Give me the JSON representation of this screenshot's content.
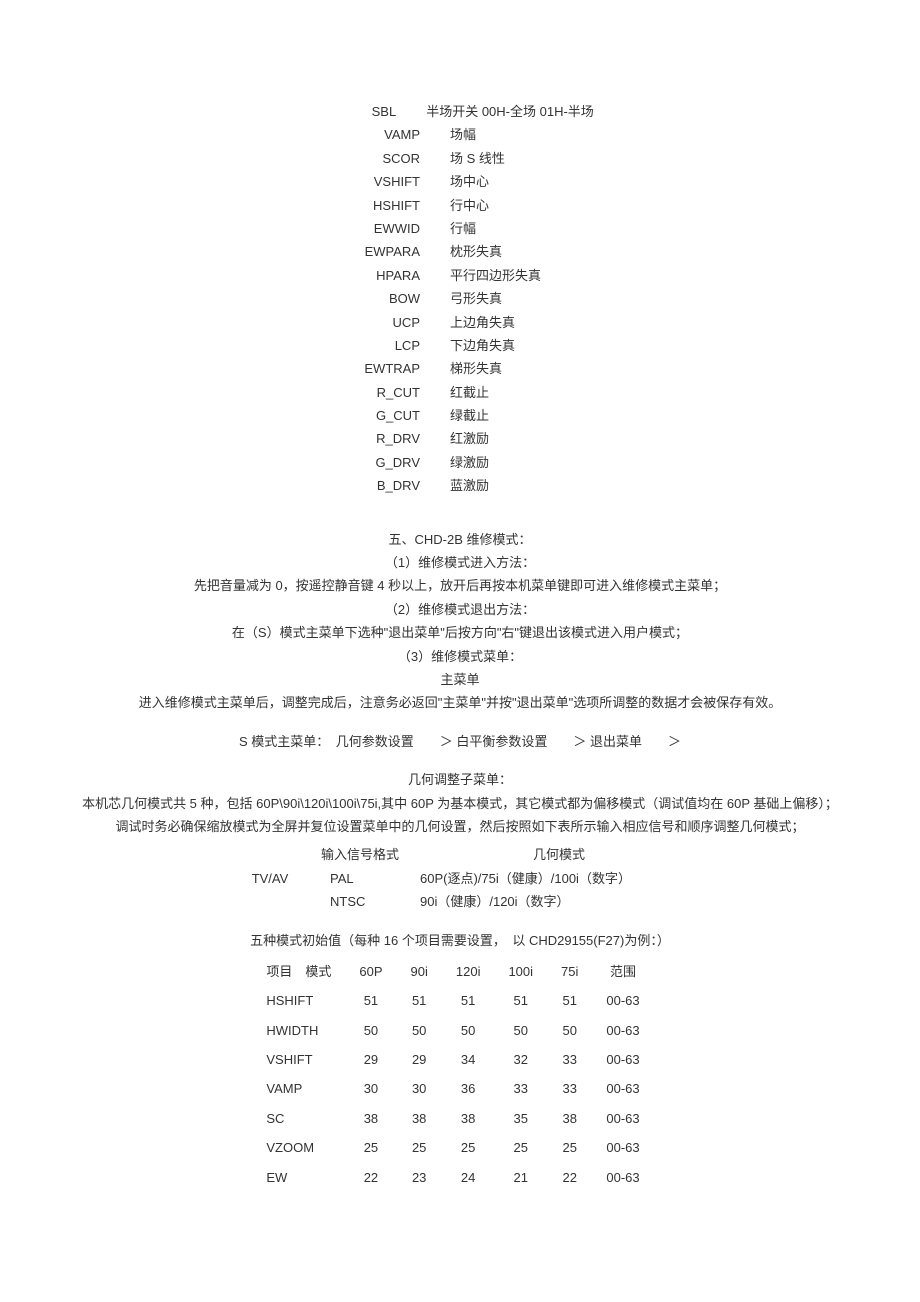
{
  "params": [
    {
      "k": "SBL",
      "v": "半场开关 00H-全场 01H-半场"
    },
    {
      "k": "VAMP",
      "v": "场幅"
    },
    {
      "k": "SCOR",
      "v": "场 S 线性"
    },
    {
      "k": "VSHIFT",
      "v": "场中心"
    },
    {
      "k": "HSHIFT",
      "v": "行中心"
    },
    {
      "k": "EWWID",
      "v": "行幅"
    },
    {
      "k": "EWPARA",
      "v": "枕形失真"
    },
    {
      "k": "HPARA",
      "v": "平行四边形失真"
    },
    {
      "k": "BOW",
      "v": "弓形失真"
    },
    {
      "k": "UCP",
      "v": "上边角失真"
    },
    {
      "k": "LCP",
      "v": "下边角失真"
    },
    {
      "k": "EWTRAP",
      "v": "梯形失真"
    },
    {
      "k": "R_CUT",
      "v": "红截止"
    },
    {
      "k": "G_CUT",
      "v": "绿截止"
    },
    {
      "k": "R_DRV",
      "v": "红激励"
    },
    {
      "k": "G_DRV",
      "v": "绿激励"
    },
    {
      "k": "B_DRV",
      "v": "蓝激励"
    }
  ],
  "s5_title": "五、CHD-2B 维修模式：",
  "s5_1": "（1）维修模式进入方法：",
  "s5_1_body": "先把音量减为 0，按遥控静音键 4 秒以上，放开后再按本机菜单键即可进入维修模式主菜单；",
  "s5_2": "（2）维修模式退出方法：",
  "s5_2_body": "在（S）模式主菜单下选种\"退出菜单\"后按方向\"右\"键退出该模式进入用户模式；",
  "s5_3": "（3）维修模式菜单：",
  "main_menu_label": "主菜单",
  "main_menu_note": "进入维修模式主菜单后，调整完成后，注意务必返回\"主菜单\"并按\"退出菜单\"选项所调整的数据才会被保存有效。",
  "s_menu_line": "S 模式主菜单：　几何参数设置　　＞ 白平衡参数设置　　＞ 退出菜单　　＞",
  "geo_title": "几何调整子菜单：",
  "geo_p1": "本机芯几何模式共 5 种，包括 60P\\90i\\120i\\100i\\75i,其中 60P 为基本模式，其它模式都为偏移模式（调试值均在 60P 基础上偏移）；",
  "geo_p2": "调试时务必确保缩放模式为全屏并复位设置菜单中的几何设置，然后按照如下表所示输入相应信号和顺序调整几何模式；",
  "sig_header_left": "输入信号格式",
  "sig_header_right": "几何模式",
  "sig_rows": [
    {
      "c1": "TV/AV",
      "c2": "PAL",
      "c3": "60P(逐点)/75i（健康）/100i（数字）"
    },
    {
      "c1": "",
      "c2": "NTSC",
      "c3": "90i（健康）/120i（数字）"
    }
  ],
  "init_title": "五种模式初始值（每种 16 个项目需要设置，　以 CHD29155(F27)为例：）",
  "init_header": [
    "项目　模式",
    "60P",
    "90i",
    "120i",
    "100i",
    "75i",
    "范围"
  ],
  "init_rows": [
    {
      "n": "HSHIFT",
      "v": [
        "51",
        "51",
        "51",
        "51",
        "51",
        "00-63"
      ]
    },
    {
      "n": "HWIDTH",
      "v": [
        "50",
        "50",
        "50",
        "50",
        "50",
        "00-63"
      ]
    },
    {
      "n": "VSHIFT",
      "v": [
        "29",
        "29",
        "34",
        "32",
        "33",
        "00-63"
      ]
    },
    {
      "n": "VAMP",
      "v": [
        "30",
        "30",
        "36",
        "33",
        "33",
        "00-63"
      ]
    },
    {
      "n": "SC",
      "v": [
        "38",
        "38",
        "38",
        "35",
        "38",
        "00-63"
      ]
    },
    {
      "n": "VZOOM",
      "v": [
        "25",
        "25",
        "25",
        "25",
        "25",
        "00-63"
      ]
    },
    {
      "n": "EW",
      "v": [
        "22",
        "23",
        "24",
        "21",
        "22",
        "00-63"
      ]
    }
  ]
}
